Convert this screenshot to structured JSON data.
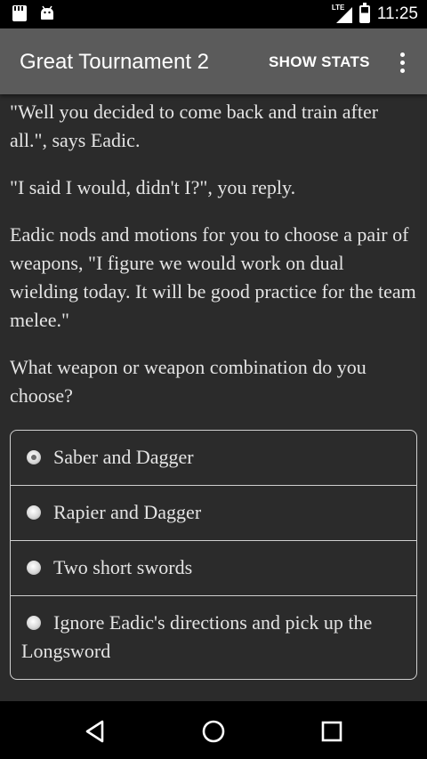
{
  "status_bar": {
    "time": "11:25",
    "network": "LTE",
    "icons_left": [
      "sd-card-icon",
      "android-icon"
    ],
    "icons_right": [
      "signal-icon",
      "battery-icon"
    ]
  },
  "app_bar": {
    "title": "Great Tournament 2",
    "stats_label": "SHOW STATS",
    "overflow_icon": "more-vert-icon"
  },
  "story": {
    "paragraphs": [
      "\"Well you decided to come back and train after all.\", says Eadic.",
      "\"I said I would, didn't I?\", you reply.",
      "Eadic nods and motions for you to choose a pair of weapons, \"I figure we would work on dual wielding today. It will be good practice for the team melee.\"",
      "What weapon or weapon combination do you choose?"
    ]
  },
  "choices": {
    "selected_index": 0,
    "options": [
      "Saber and Dagger",
      "Rapier and Dagger",
      "Two short swords",
      "Ignore Eadic's directions and pick up the Longsword"
    ]
  },
  "nav_bar": {
    "icons": [
      "back-icon",
      "home-icon",
      "recents-icon"
    ]
  }
}
